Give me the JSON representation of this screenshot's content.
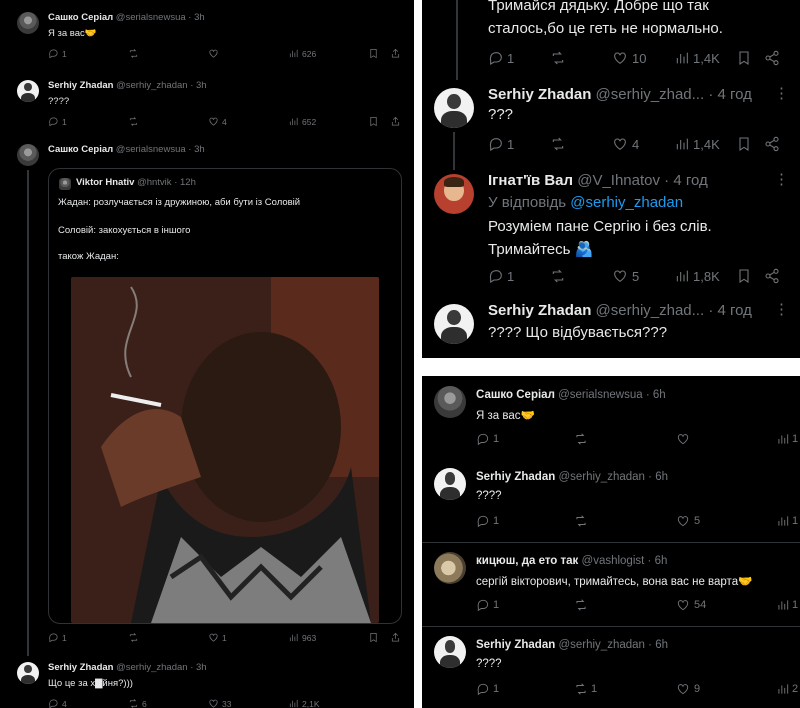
{
  "left": {
    "tweets": [
      {
        "name": "Сашко Серіал",
        "handle": "@serialsnewsua",
        "time": "3h",
        "text": "Я за вас🤝",
        "replies": "1",
        "retweets": "",
        "likes": "",
        "views": "626"
      },
      {
        "name": "Serhiy Zhadan",
        "handle": "@serhiy_zhadan",
        "time": "3h",
        "text": "????",
        "replies": "1",
        "retweets": "",
        "likes": "4",
        "views": "652"
      },
      {
        "name": "Сашко Серіал",
        "handle": "@serialsnewsua",
        "time": "3h",
        "text": "",
        "replies": "1",
        "retweets": "",
        "likes": "1",
        "views": "963"
      },
      {
        "name": "Serhiy Zhadan",
        "handle": "@serhiy_zhadan",
        "time": "3h",
        "text": "Що це за х▇йня?)))",
        "replies": "4",
        "retweets": "6",
        "likes": "33",
        "views": "2,1K"
      }
    ],
    "quote": {
      "name": "Viktor Hnativ",
      "handle": "@hntvik",
      "time": "12h",
      "line1": "Жадан: розлучається із дружиною, аби бути із Соловій",
      "line2": "Соловій: закохується в іншого",
      "line3": "також Жадан:"
    }
  },
  "right_top": {
    "tweets": [
      {
        "text1": "Тримайся дядьку. Добре що так",
        "text2": "сталось,бо це геть не нормально.",
        "replies": "1",
        "retweets": "",
        "likes": "10",
        "views": "1,4K"
      },
      {
        "name": "Serhiy Zhadan",
        "handle": "@serhiy_zhad...",
        "time": "4 год",
        "text": "???",
        "replies": "1",
        "retweets": "",
        "likes": "4",
        "views": "1,4K"
      },
      {
        "name": "Ігнат'їв Вал",
        "handle": "@V_Ihnatov",
        "time": "4 год",
        "reply_prefix": "У відповідь",
        "reply_to": "@serhiy_zhadan",
        "text1": "Розуміем пане Сергію і без слів.",
        "text2": "Тримайтесь 🫂",
        "replies": "1",
        "retweets": "",
        "likes": "5",
        "views": "1,8K"
      },
      {
        "name": "Serhiy Zhadan",
        "handle": "@serhiy_zhad...",
        "time": "4 год",
        "text": "???? Що відбувається???"
      }
    ]
  },
  "right_bottom": {
    "tweets": [
      {
        "name": "Сашко Серіал",
        "handle": "@serialsnewsua",
        "time": "6h",
        "text": "Я за вас🤝",
        "replies": "1",
        "retweets": "",
        "likes": "",
        "views": "1"
      },
      {
        "name": "Serhiy Zhadan",
        "handle": "@serhiy_zhadan",
        "time": "6h",
        "text": "????",
        "replies": "1",
        "retweets": "",
        "likes": "5",
        "views": "1"
      },
      {
        "name": "кицюш, да ето так",
        "handle": "@vashlogist",
        "time": "6h",
        "text": "сергій вікторович, тримайтесь, вона вас не варта🤝",
        "replies": "1",
        "retweets": "",
        "likes": "54",
        "views": "1"
      },
      {
        "name": "Serhiy Zhadan",
        "handle": "@serhiy_zhadan",
        "time": "6h",
        "text": "????",
        "replies": "1",
        "retweets": "1",
        "likes": "9",
        "views": "2"
      }
    ]
  },
  "icons": {
    "reply": "reply-icon",
    "retweet": "retweet-icon",
    "like": "heart-icon",
    "views": "views-icon",
    "bookmark": "bookmark-icon",
    "share": "share-icon",
    "more": "more-icon"
  }
}
